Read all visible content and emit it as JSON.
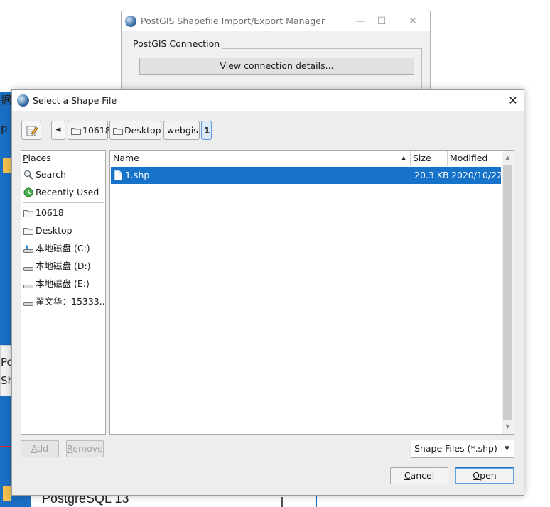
{
  "background": {
    "side_glyphs": [
      "据",
      "p"
    ],
    "card_glyphs": [
      "Po",
      "Sh"
    ],
    "bottom_text": "PostgreSQL 13"
  },
  "back_window": {
    "title": "PostGIS Shapefile Import/Export Manager",
    "minimize": "—",
    "maximize": "☐",
    "close": "✕",
    "group_label": "PostGIS Connection",
    "view_button": "View connection details..."
  },
  "dialog": {
    "title": "Select a Shape File",
    "close": "✕",
    "path_nav": {
      "back": "◀",
      "crumbs": [
        "10618",
        "Desktop",
        "webgis",
        "1"
      ]
    },
    "places": {
      "header_prefix": "P",
      "header_rest": "laces",
      "items": [
        {
          "label": "Search",
          "icon": "search-icon"
        },
        {
          "label": "Recently Used",
          "icon": "recent-icon"
        },
        {
          "label": "10618",
          "icon": "folder-icon"
        },
        {
          "label": "Desktop",
          "icon": "folder-icon"
        },
        {
          "label": "本地磁盘 (C:)",
          "icon": "drive-icon"
        },
        {
          "label": "本地磁盘 (D:)",
          "icon": "drive-icon"
        },
        {
          "label": "本地磁盘 (E:)",
          "icon": "drive-icon"
        },
        {
          "label": "翟文华：15333...",
          "icon": "drive-icon"
        }
      ]
    },
    "file_list": {
      "columns": {
        "name": "Name",
        "size": "Size",
        "modified": "Modified"
      },
      "rows": [
        {
          "name": "1.shp",
          "size": "20.3 KB",
          "modified": "2020/10/22",
          "selected": true
        }
      ]
    },
    "buttons": {
      "add_prefix": "A",
      "add_rest": "dd",
      "remove_prefix": "R",
      "remove_rest": "emove",
      "cancel_prefix": "C",
      "cancel_rest": "ancel",
      "open_prefix": "O",
      "open_rest": "pen"
    },
    "filter": {
      "selected": "Shape Files (*.shp)",
      "arrow": "▼"
    }
  },
  "colors": {
    "selection": "#1673c9",
    "taskbar": "#1a6fc4",
    "dialog_bg": "#ededed"
  }
}
